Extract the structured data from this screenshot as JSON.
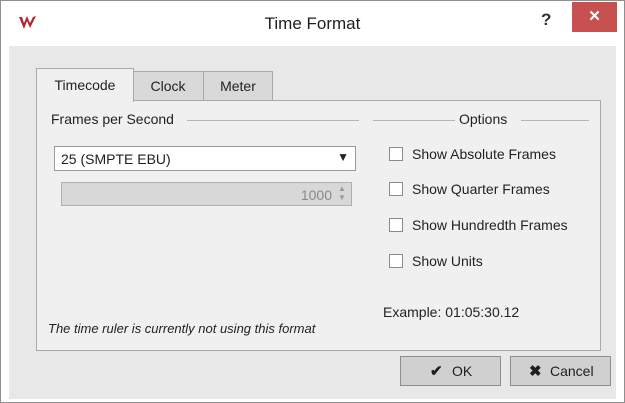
{
  "window": {
    "title": "Time Format",
    "help_label": "?",
    "close_label": "✕"
  },
  "tabs": [
    {
      "label": "Timecode",
      "active": true
    },
    {
      "label": "Clock",
      "active": false
    },
    {
      "label": "Meter",
      "active": false
    }
  ],
  "frames": {
    "group_label": "Frames per Second",
    "selected": "25 (SMPTE EBU)",
    "spin_value": "1000"
  },
  "options": {
    "group_label": "Options",
    "items": [
      {
        "label": "Show Absolute Frames",
        "checked": false
      },
      {
        "label": "Show Quarter Frames",
        "checked": false
      },
      {
        "label": "Show Hundredth Frames",
        "checked": false
      },
      {
        "label": "Show Units",
        "checked": false
      }
    ],
    "example": "Example: 01:05:30.12"
  },
  "note": "The time ruler is currently not using this format",
  "buttons": {
    "ok": "OK",
    "cancel": "Cancel"
  },
  "colors": {
    "close_bg": "#c75050",
    "panel_bg": "#f0f0f0",
    "client_bg": "#e8e8e8"
  },
  "icons": {
    "app": "wavelab-logo-icon",
    "ok": "checkmark-icon",
    "cancel": "x-icon"
  }
}
